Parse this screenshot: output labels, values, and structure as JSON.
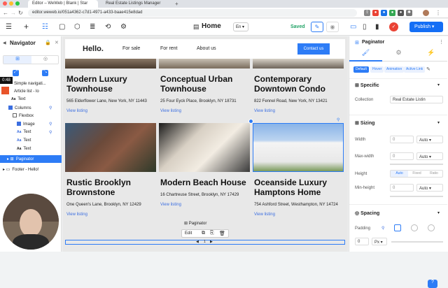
{
  "browser": {
    "tabs": [
      {
        "label": "Editor – WeWeb | Blank | Star"
      },
      {
        "label": "Real Estate Listings Manager"
      }
    ],
    "url": "editor.weweb.io/051a4362-c7d1-4971-a433-baae415e8dad"
  },
  "toolbar": {
    "page_title": "Home",
    "language": "En",
    "saved_label": "Saved",
    "publish_label": "Publish"
  },
  "navigator": {
    "title": "Navigator",
    "rows": [
      {
        "label": "Simple navigati..."
      },
      {
        "label": "Article list - lo"
      },
      {
        "label": "Text"
      },
      {
        "label": "Columns"
      },
      {
        "label": "Flexbox"
      },
      {
        "label": "Image"
      },
      {
        "label": "Text"
      },
      {
        "label": "Text"
      },
      {
        "label": "Paginator"
      },
      {
        "label": "Footer - Hello!"
      }
    ],
    "time_badge": "0:48"
  },
  "site": {
    "brand": "Hello.",
    "nav": [
      "For sale",
      "For rent",
      "About us"
    ],
    "contact_label": "Contact us"
  },
  "listings": [
    {
      "title": "Modern Luxury Townhouse",
      "address": "565 Elderflower Lane, New York, NY 11443",
      "link": "View listing"
    },
    {
      "title": "Conceptual Urban Townhouse",
      "address": "25 Four Eyck Place, Brooklyn, NY 18731",
      "link": "View listing"
    },
    {
      "title": "Contemporary Downtown Condo",
      "address": "822 Fennel Road, New York, NY 13421",
      "link": "View listing"
    },
    {
      "title": "Rustic Brooklyn Brownstone",
      "address": "One Queen's Lane, Brooklyn, NY 12429",
      "link": "View listing"
    },
    {
      "title": "Modern Beach House",
      "address": "16 Chartreuse Street, Brooklyn, NY 17429",
      "link": "View listing"
    },
    {
      "title": "Oceanside Luxury Hamptons Home",
      "address": "754 Ashford Street, Westhampton, NY 14724",
      "link": "View listing"
    }
  ],
  "paginator": {
    "label": "Paginator",
    "edit_label": "Edit",
    "page": "1"
  },
  "panel": {
    "title": "Paginator",
    "states": [
      "Default",
      "Hover",
      "Animation",
      "Active Link"
    ],
    "specific": "Specific",
    "collection_label": "Collection",
    "collection_value": "Real Estate Listin",
    "sizing": "Sizing",
    "width_label": "Width",
    "width_value": "0",
    "width_unit": "Auto",
    "maxwidth_label": "Max-width",
    "maxwidth_value": "0",
    "maxwidth_unit": "Auto",
    "height_label": "Height",
    "height_opts": [
      "Auto",
      "Fixed",
      "Ratio"
    ],
    "minheight_label": "Min-height",
    "minheight_value": "0",
    "minheight_unit": "Auto",
    "spacing": "Spacing",
    "padding_label": "Padding",
    "padding_value": "0",
    "padding_unit": "Px"
  },
  "colors": {
    "accent": "#146ef5",
    "selection": "#2d7cf6",
    "saved": "#21a366",
    "link": "#3b6ee0"
  }
}
